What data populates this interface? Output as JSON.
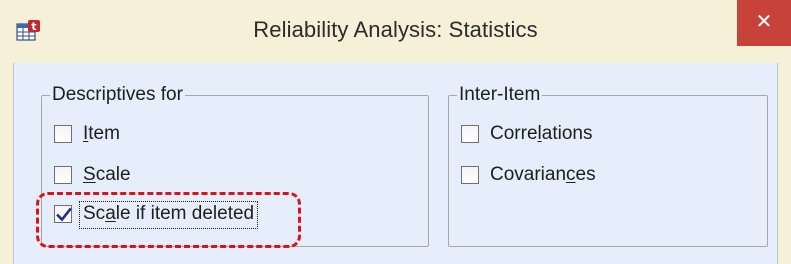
{
  "window": {
    "title": "Reliability Analysis: Statistics",
    "close_glyph": "✕",
    "app_icon": "spss-table-icon"
  },
  "descriptives": {
    "legend": "Descriptives for",
    "items": [
      {
        "pre": "",
        "mn": "I",
        "post": "tem",
        "checked": false
      },
      {
        "pre": "",
        "mn": "S",
        "post": "cale",
        "checked": false
      },
      {
        "pre": "Sc",
        "mn": "a",
        "post": "le if item deleted",
        "checked": true
      }
    ]
  },
  "inter_item": {
    "legend": "Inter-Item",
    "items": [
      {
        "pre": "Corre",
        "mn": "l",
        "post": "ations",
        "checked": false
      },
      {
        "pre": "Covarian",
        "mn": "c",
        "post": "es",
        "checked": false
      }
    ]
  },
  "annotation": {
    "highlight_color": "#e01018"
  }
}
